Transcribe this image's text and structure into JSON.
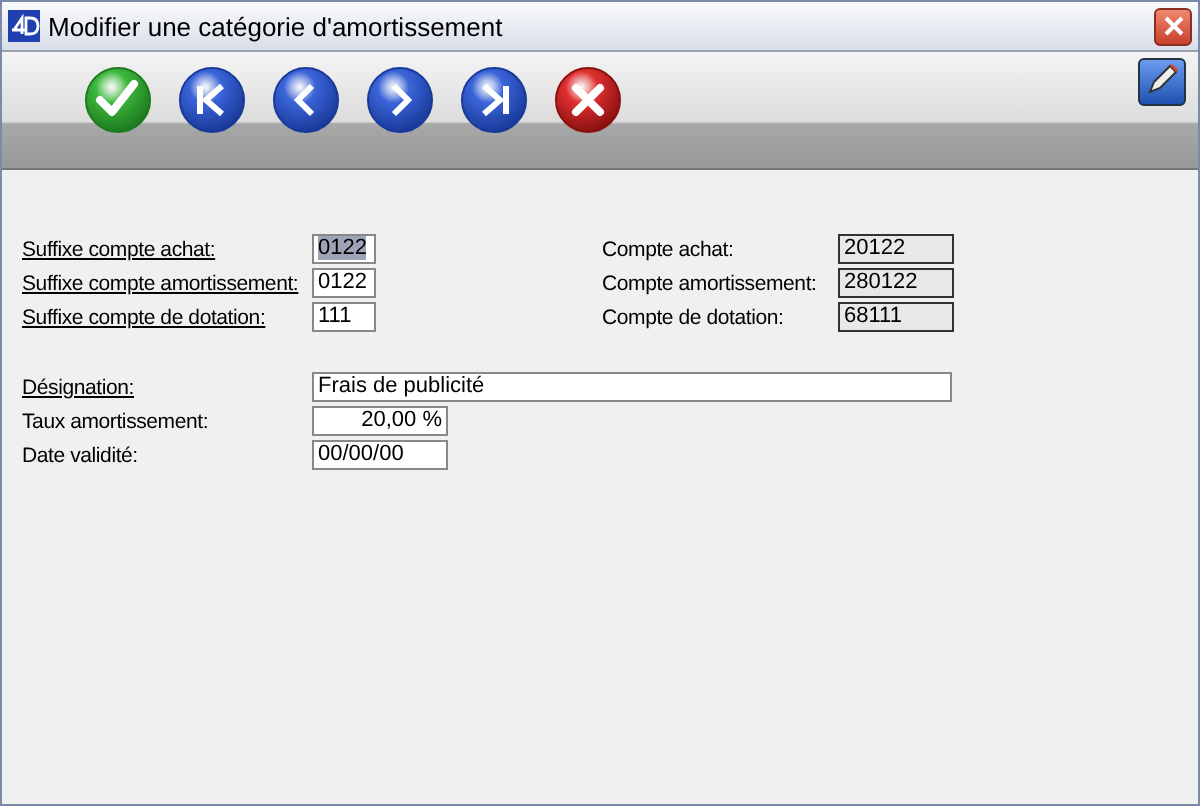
{
  "window": {
    "title": "Modifier une catégorie d'amortissement"
  },
  "toolbar": {
    "buttons": [
      {
        "kind": "validate"
      },
      {
        "kind": "first"
      },
      {
        "kind": "previous"
      },
      {
        "kind": "next"
      },
      {
        "kind": "last"
      },
      {
        "kind": "cancel"
      }
    ]
  },
  "suffix_fields": [
    {
      "label": "Suffixe compte achat:",
      "underlined": true,
      "value": "0122",
      "highlighted": true
    },
    {
      "label": "Suffixe compte amortissement:",
      "underlined": true,
      "value": "0122",
      "highlighted": false
    },
    {
      "label": "Suffixe compte de dotation:",
      "underlined": true,
      "value": "111",
      "highlighted": false
    }
  ],
  "account_fields": [
    {
      "label": "Compte achat:",
      "value": "20122"
    },
    {
      "label": "Compte amortissement:",
      "value": "280122"
    },
    {
      "label": "Compte de dotation:",
      "value": "68111"
    }
  ],
  "detail_fields": [
    {
      "kind": "text",
      "label": "Désignation:",
      "underlined": true,
      "value": "Frais de publicité"
    },
    {
      "kind": "percent",
      "label": "Taux amortissement:",
      "underlined": false,
      "value": "20,00 %"
    },
    {
      "kind": "date",
      "label": "Date validité:",
      "underlined": false,
      "value": "00/00/00"
    }
  ]
}
